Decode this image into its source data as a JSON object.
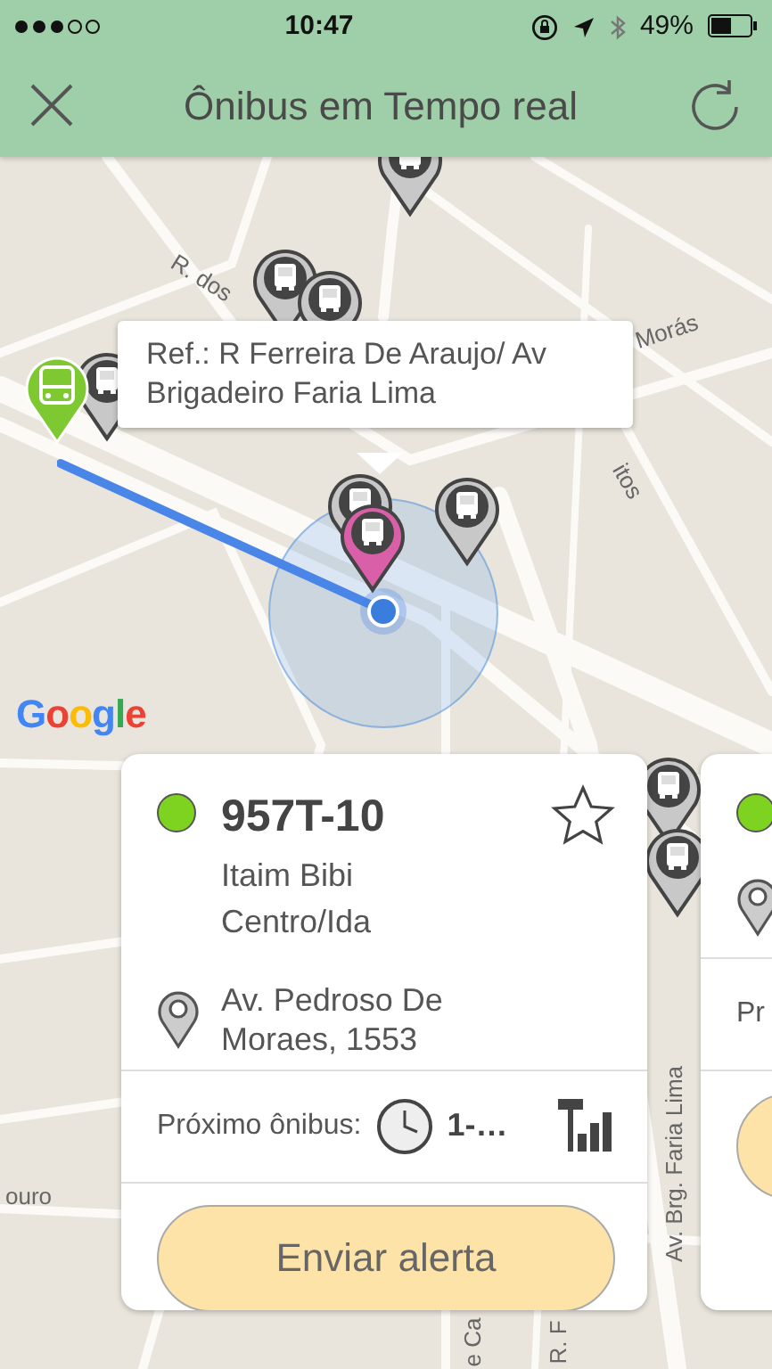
{
  "status_bar": {
    "time": "10:47",
    "battery": "49%"
  },
  "header": {
    "title": "Ônibus em Tempo real"
  },
  "map": {
    "street_labels": [
      {
        "text": "R. dos",
        "kind": "diagonal"
      },
      {
        "text": "Morás",
        "kind": "tilted"
      },
      {
        "text": "itos",
        "kind": "steep"
      },
      {
        "text": "Av. Brg. Faria Lima",
        "kind": "vertical"
      },
      {
        "text": "e Ca",
        "kind": "vertical"
      },
      {
        "text": "R. F",
        "kind": "vertical"
      },
      {
        "text": "ouro",
        "kind": "flat"
      }
    ],
    "marker_groups": [
      {
        "markers": [
          {
            "kind": "stop"
          }
        ]
      },
      {
        "markers": [
          {
            "kind": "stop"
          },
          {
            "kind": "stop"
          }
        ]
      },
      {
        "markers": [
          {
            "kind": "stop"
          },
          {
            "kind": "vehicle"
          }
        ]
      },
      {
        "markers": [
          {
            "kind": "stop"
          },
          {
            "kind": "selected"
          }
        ]
      },
      {
        "markers": [
          {
            "kind": "stop"
          }
        ]
      },
      {
        "markers": [
          {
            "kind": "stop"
          },
          {
            "kind": "stop"
          }
        ]
      }
    ],
    "callout": {
      "text": "Ref.: R Ferreira De Araujo/ Av Brigadeiro Faria Lima"
    },
    "logo": "Google"
  },
  "cards": [
    {
      "line": "957T-10",
      "color": "#7ed321",
      "favorite": false,
      "destination_1": "Itaim Bibi",
      "destination_2": "Centro/Ida",
      "address": "Av. Pedroso De Moraes, 1553",
      "next_label": "Próximo ônibus:",
      "next_time": "1-…",
      "button": "Enviar alerta"
    },
    {
      "color": "#7ed321",
      "next_label": "Pr"
    }
  ]
}
